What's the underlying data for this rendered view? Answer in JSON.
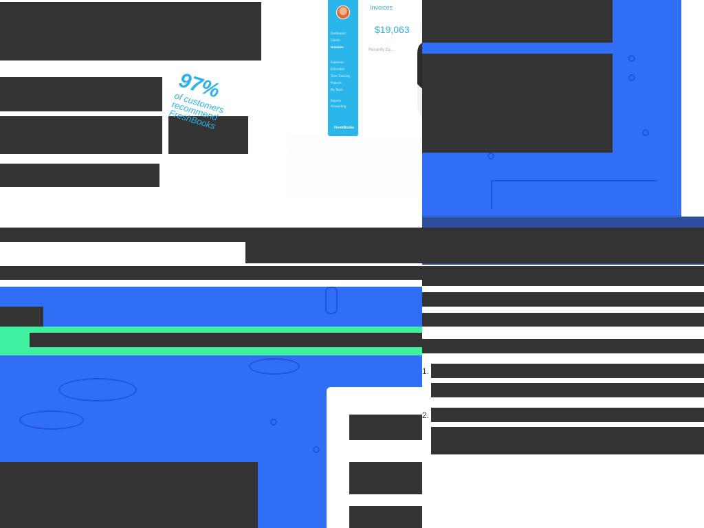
{
  "hero_app_preview": {
    "invoices_title": "Invoices",
    "invoice_amount": "$19,063",
    "recent_label": "Recently Ex...",
    "sidebar_items": [
      "Dashboard",
      "Clients",
      "Invoices",
      "Expenses",
      "Estimates",
      "Time Tracking",
      "Projects",
      "My Team",
      "Reports",
      "Accounting"
    ],
    "sidebar_logo": "FreshBooks"
  },
  "promo_stat": {
    "percent": "97%",
    "line1": "of customers",
    "line2": "recommend",
    "line3": "FreshBooks"
  },
  "ordered_list": {
    "item1_number": "1.",
    "item2_number": "2."
  },
  "colors": {
    "accent_blue": "#2f6ef5",
    "accent_mint": "#3ef0a0",
    "brand_cyan": "#2ab6ea",
    "redaction": "#333333"
  }
}
